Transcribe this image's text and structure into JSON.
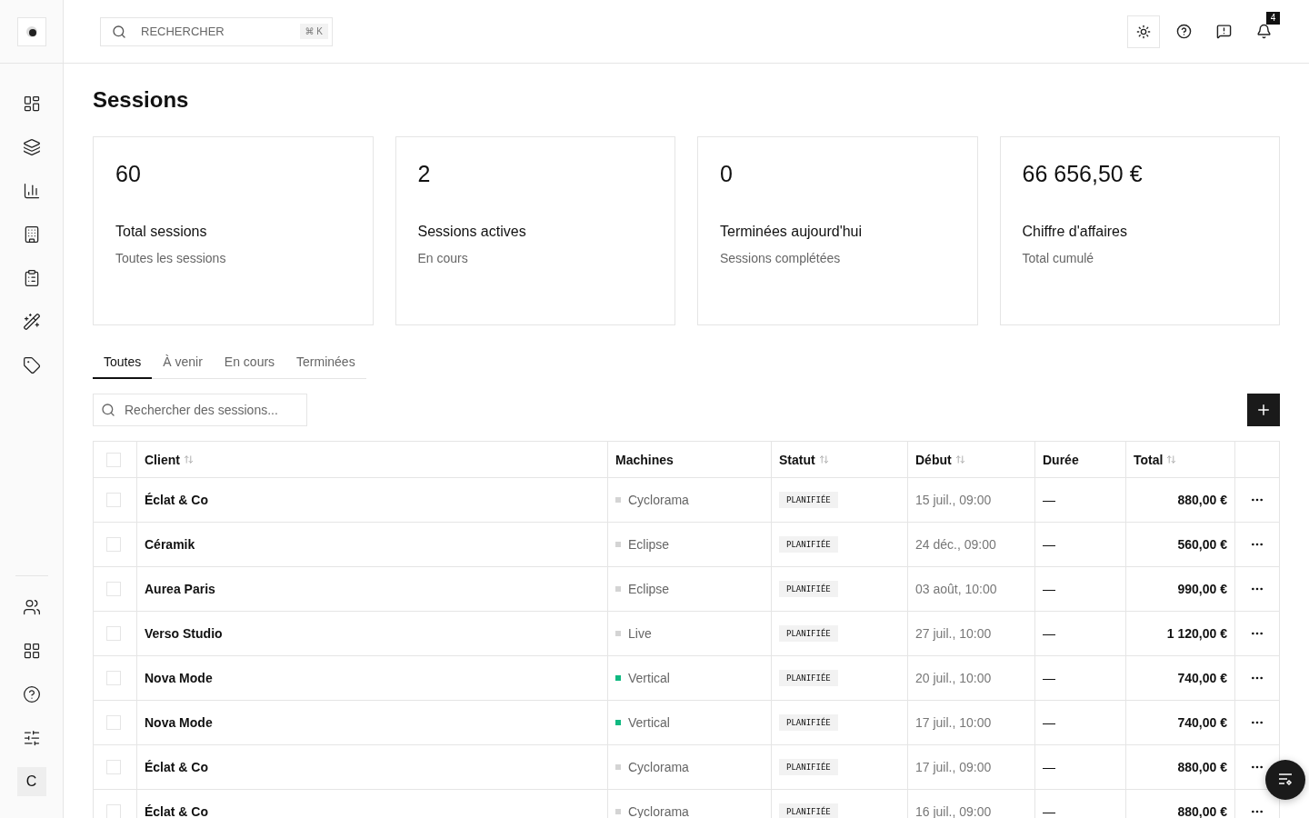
{
  "topbar": {
    "search": {
      "placeholder": "RECHERCHER",
      "shortcut": "⌘ K"
    },
    "notifications": "4"
  },
  "sidebar": {
    "avatar": "C"
  },
  "title": "Sessions",
  "stats": [
    {
      "value": "60",
      "label": "Total sessions",
      "sub": "Toutes les sessions"
    },
    {
      "value": "2",
      "label": "Sessions actives",
      "sub": "En cours"
    },
    {
      "value": "0",
      "label": "Terminées aujourd'hui",
      "sub": "Sessions complétées"
    },
    {
      "value": "66 656,50 €",
      "label": "Chiffre d'affaires",
      "sub": "Total cumulé"
    }
  ],
  "tabs": [
    {
      "label": "Toutes",
      "selected": true
    },
    {
      "label": "À venir",
      "selected": false
    },
    {
      "label": "En cours",
      "selected": false
    },
    {
      "label": "Terminées",
      "selected": false
    }
  ],
  "filter": {
    "placeholder": "Rechercher des sessions..."
  },
  "table": {
    "select_all": {
      "checked": false
    },
    "columns": [
      {
        "label": "Client",
        "sortable": true
      },
      {
        "label": "Machines",
        "sortable": false
      },
      {
        "label": "Statut",
        "sortable": true
      },
      {
        "label": "Début",
        "sortable": true
      },
      {
        "label": "Durée",
        "sortable": false
      },
      {
        "label": "Total",
        "sortable": true
      }
    ],
    "rows": [
      {
        "checked": false,
        "client": "Éclat & Co",
        "machine": "Cyclorama",
        "color": "#d4d4d4",
        "status": "PLANIFIÉE",
        "start": "15 juil., 09:00",
        "duration": "—",
        "total": "880,00 €"
      },
      {
        "checked": false,
        "client": "Céramik",
        "machine": "Eclipse",
        "color": "#d4d4d4",
        "status": "PLANIFIÉE",
        "start": "24 déc., 09:00",
        "duration": "—",
        "total": "560,00 €"
      },
      {
        "checked": false,
        "client": "Aurea Paris",
        "machine": "Eclipse",
        "color": "#d4d4d4",
        "status": "PLANIFIÉE",
        "start": "03 août, 10:00",
        "duration": "—",
        "total": "990,00 €"
      },
      {
        "checked": false,
        "client": "Verso Studio",
        "machine": "Live",
        "color": "#d4d4d4",
        "status": "PLANIFIÉE",
        "start": "27 juil., 10:00",
        "duration": "—",
        "total": "1 120,00 €"
      },
      {
        "checked": false,
        "client": "Nova Mode",
        "machine": "Vertical",
        "color": "#10b981",
        "status": "PLANIFIÉE",
        "start": "20 juil., 10:00",
        "duration": "—",
        "total": "740,00 €"
      },
      {
        "checked": false,
        "client": "Nova Mode",
        "machine": "Vertical",
        "color": "#10b981",
        "status": "PLANIFIÉE",
        "start": "17 juil., 10:00",
        "duration": "—",
        "total": "740,00 €"
      },
      {
        "checked": false,
        "client": "Éclat & Co",
        "machine": "Cyclorama",
        "color": "#d4d4d4",
        "status": "PLANIFIÉE",
        "start": "17 juil., 09:00",
        "duration": "—",
        "total": "880,00 €"
      },
      {
        "checked": false,
        "client": "Éclat & Co",
        "machine": "Cyclorama",
        "color": "#d4d4d4",
        "status": "PLANIFIÉE",
        "start": "16 juil., 09:00",
        "duration": "—",
        "total": "880,00 €"
      }
    ]
  }
}
